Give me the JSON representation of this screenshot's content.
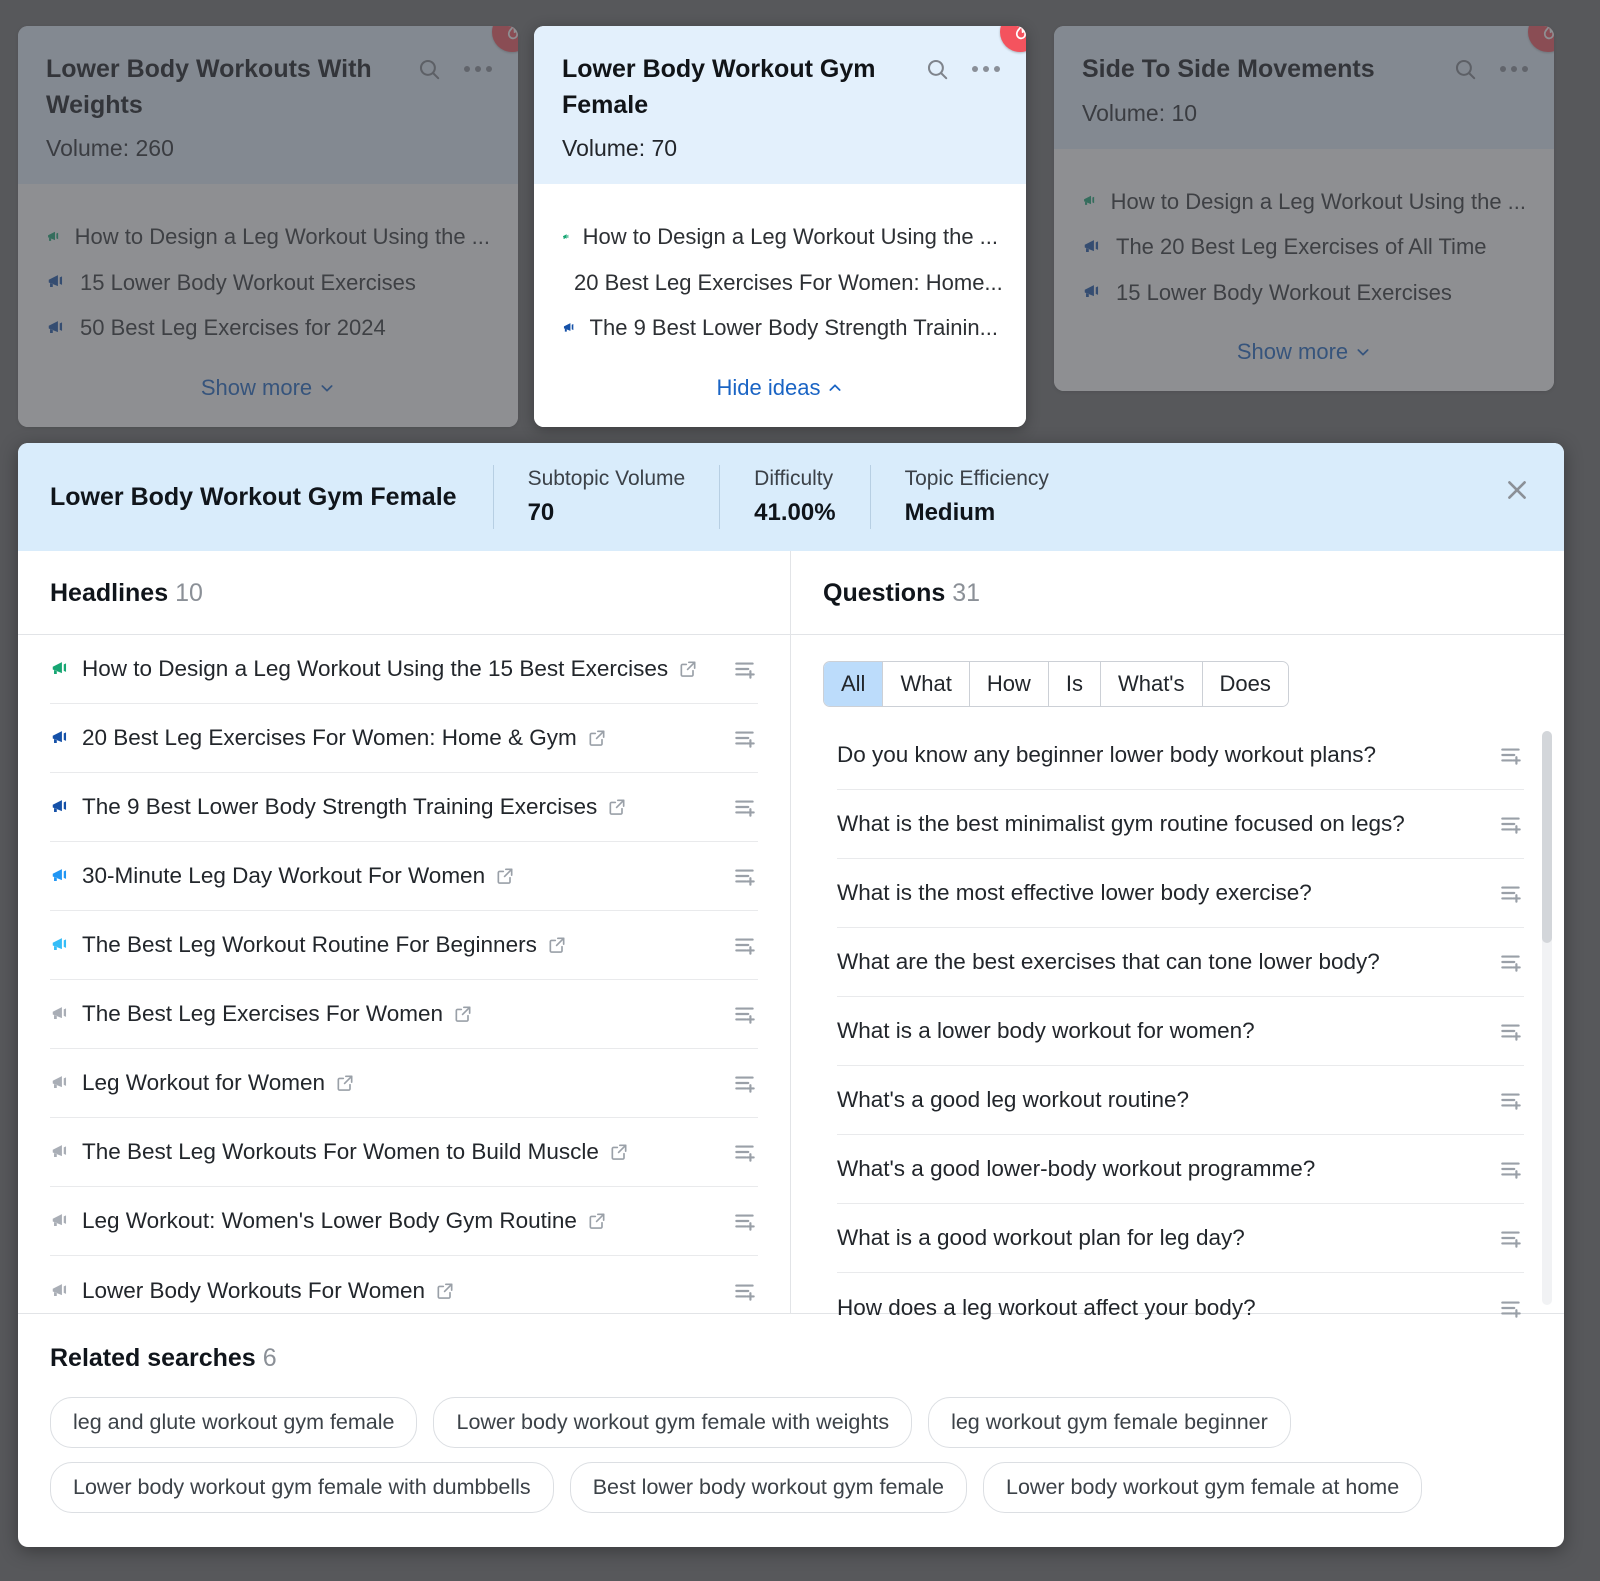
{
  "cards": [
    {
      "title": "Lower Body Workouts With Weights",
      "volume_label": "Volume: 260",
      "ideas": [
        {
          "text": "How to Design a Leg Workout Using the ...",
          "color": "#17a673"
        },
        {
          "text": "15 Lower Body Workout Exercises",
          "color": "#1551a8"
        },
        {
          "text": "50 Best Leg Exercises for 2024",
          "color": "#1551a8"
        }
      ],
      "footer": "Show more",
      "footer_dir": "down",
      "hot": true
    },
    {
      "title": "Lower Body Workout Gym Female",
      "volume_label": "Volume: 70",
      "ideas": [
        {
          "text": "How to Design a Leg Workout Using the ...",
          "color": "#17a673"
        },
        {
          "text": "20 Best Leg Exercises For Women: Home...",
          "color": "#1551a8"
        },
        {
          "text": "The 9 Best Lower Body Strength Trainin...",
          "color": "#1551a8"
        }
      ],
      "footer": "Hide ideas",
      "footer_dir": "up",
      "hot": true
    },
    {
      "title": "Side To Side Movements",
      "volume_label": "Volume: 10",
      "ideas": [
        {
          "text": "How to Design a Leg Workout Using the ...",
          "color": "#17a673"
        },
        {
          "text": "The 20 Best Leg Exercises of All Time",
          "color": "#1551a8"
        },
        {
          "text": "15 Lower Body Workout Exercises",
          "color": "#1551a8"
        }
      ],
      "footer": "Show more",
      "footer_dir": "down",
      "hot": true
    }
  ],
  "modal": {
    "title": "Lower Body Workout Gym Female",
    "metrics": [
      {
        "label": "Subtopic Volume",
        "value": "70"
      },
      {
        "label": "Difficulty",
        "value": "41.00%"
      },
      {
        "label": "Topic Efficiency",
        "value": "Medium"
      }
    ],
    "close_label": "×",
    "headlines": {
      "heading": "Headlines",
      "count": "10",
      "items": [
        {
          "text": "How to Design a Leg Workout Using the 15 Best Exercises",
          "color": "#17a673"
        },
        {
          "text": "20 Best Leg Exercises For Women: Home & Gym",
          "color": "#1551a8"
        },
        {
          "text": "The 9 Best Lower Body Strength Training Exercises",
          "color": "#1551a8"
        },
        {
          "text": "30-Minute Leg Day Workout For Women",
          "color": "#2196f3"
        },
        {
          "text": "The Best Leg Workout Routine For Beginners",
          "color": "#35bdf7"
        },
        {
          "text": "The Best Leg Exercises For Women",
          "color": "#a9aeb6"
        },
        {
          "text": "Leg Workout for Women",
          "color": "#a9aeb6"
        },
        {
          "text": "The Best Leg Workouts For Women to Build Muscle",
          "color": "#a9aeb6"
        },
        {
          "text": "Leg Workout: Women's Lower Body Gym Routine",
          "color": "#a9aeb6"
        },
        {
          "text": "Lower Body Workouts For Women",
          "color": "#a9aeb6"
        }
      ]
    },
    "questions": {
      "heading": "Questions",
      "count": "31",
      "filters": [
        "All",
        "What",
        "How",
        "Is",
        "What's",
        "Does"
      ],
      "selected_filter": "All",
      "items": [
        "Do you know any beginner lower body workout plans?",
        "What is the best minimalist gym routine focused on legs?",
        "What is the most effective lower body exercise?",
        "What are the best exercises that can tone lower body?",
        "What is a lower body workout for women?",
        "What's a good leg workout routine?",
        "What's a good lower-body workout programme?",
        "What is a good workout plan for leg day?",
        "How does a leg workout affect your body?"
      ]
    },
    "related": {
      "heading": "Related searches",
      "count": "6",
      "items": [
        "leg and glute workout gym female",
        "Lower body workout gym female with weights",
        "leg workout gym female beginner",
        "Lower body workout gym female with dumbbells",
        "Best lower body workout gym female",
        "Lower body workout gym female at home"
      ]
    }
  },
  "colors": {
    "accent_blue": "#1a64c4",
    "hot_red": "#f4535e",
    "header_blue": "#d9ecfb",
    "card_header_blue": "#e3f0fc"
  }
}
